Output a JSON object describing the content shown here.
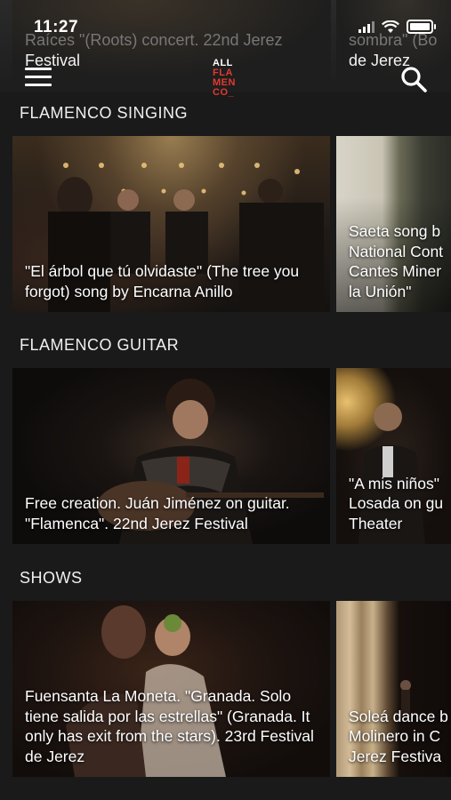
{
  "status_bar": {
    "time": "11:27"
  },
  "app": {
    "logo_line1": "ALL",
    "logo_line2": "FLA",
    "logo_line3": "MEN",
    "logo_line4": "CO_"
  },
  "header_peek": [
    {
      "line1": "Raíces \"(Roots) concert. 22nd Jerez",
      "line2": "Festival"
    },
    {
      "line1": "sombra\" (Bo",
      "line2": "de Jerez"
    }
  ],
  "sections": [
    {
      "title": "FLAMENCO SINGING",
      "cards": [
        {
          "caption": "\"El árbol que tú olvidaste\" (The tree you forgot) song by Encarna Anillo"
        },
        {
          "caption": "Saeta song by National Cont Cantes Miner la Unión\"",
          "lines": [
            "Saeta song b",
            "National Cont",
            "Cantes Miner",
            "la Unión\""
          ]
        }
      ]
    },
    {
      "title": "FLAMENCO GUITAR",
      "cards": [
        {
          "caption": "Free creation. Juán Jiménez on guitar. \"Flamenca\". 22nd Jerez Festival"
        },
        {
          "caption": "\"A mis niños\" Losada on gu Theater",
          "lines": [
            "\"A mis niños\"",
            "Losada on gu",
            "Theater"
          ]
        }
      ]
    },
    {
      "title": "SHOWS",
      "cards": [
        {
          "caption": "Fuensanta La Moneta. \"Granada. Solo tiene salida por las estrellas\" (Granada. It only has exit from the stars). 23rd Festival de Jerez"
        },
        {
          "caption": "Soleá dance Molinero in C Jerez Festiva",
          "lines": [
            "Soleá dance b",
            "Molinero in C",
            "Jerez Festiva"
          ]
        }
      ]
    }
  ],
  "colors": {
    "logo_accent": "#e03a2f",
    "background": "#1a1a1a"
  }
}
